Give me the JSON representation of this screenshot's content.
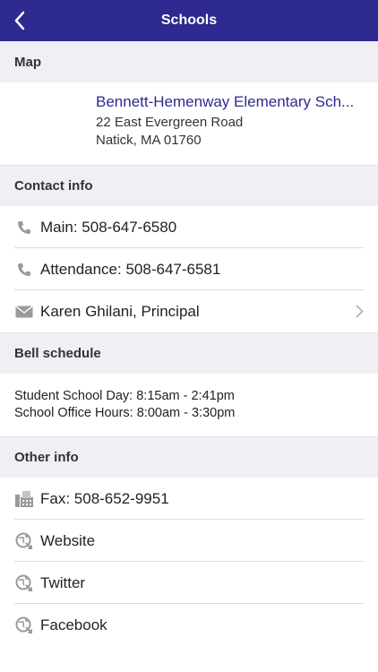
{
  "nav": {
    "title": "Schools"
  },
  "sections": {
    "map": "Map",
    "contact": "Contact info",
    "bell": "Bell schedule",
    "other": "Other info"
  },
  "map": {
    "name": "Bennett-Hemenway Elementary Sch...",
    "address1": "22 East Evergreen Road",
    "address2": "Natick, MA 01760"
  },
  "contact": {
    "main": "Main: 508-647-6580",
    "attendance": "Attendance: 508-647-6581",
    "principal": "Karen Ghilani, Principal"
  },
  "bell": {
    "line1": "Student School Day: 8:15am - 2:41pm",
    "line2": "School Office Hours: 8:00am - 3:30pm"
  },
  "other": {
    "fax": "Fax: 508-652-9951",
    "website": "Website",
    "twitter": "Twitter",
    "facebook": "Facebook"
  },
  "colors": {
    "navbar": "#2e2a8f",
    "link": "#2e2a8f",
    "section_bg": "#efeff4"
  }
}
